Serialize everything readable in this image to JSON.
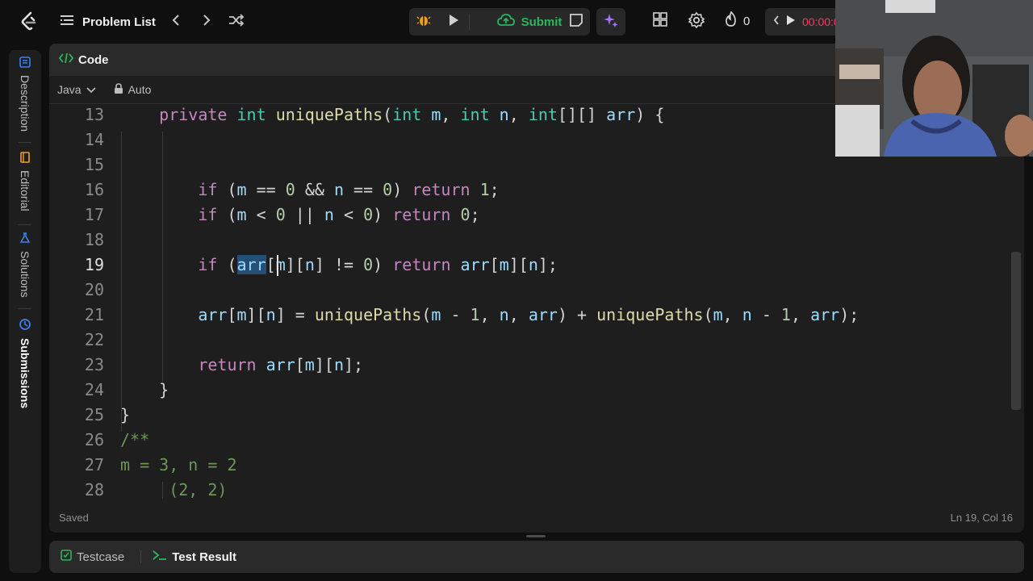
{
  "nav": {
    "problem_list_label": "Problem List",
    "submit_label": "Submit",
    "streak_count": "0",
    "timer": "00:00:0"
  },
  "sidebar": {
    "tabs": [
      {
        "label": "Description"
      },
      {
        "label": "Editorial"
      },
      {
        "label": "Solutions"
      },
      {
        "label": "Submissions"
      }
    ]
  },
  "code_panel": {
    "title": "Code",
    "language": "Java",
    "mode": "Auto",
    "status": "Saved",
    "cursor_position": "Ln 19, Col 16"
  },
  "editor": {
    "line_numbers": [
      "13",
      "14",
      "15",
      "16",
      "17",
      "18",
      "19",
      "20",
      "21",
      "22",
      "23",
      "24",
      "25",
      "26",
      "27",
      "28"
    ],
    "selected_token": "arr"
  },
  "bottom_panel": {
    "tabs": [
      {
        "label": "Testcase"
      },
      {
        "label": "Test Result"
      }
    ]
  },
  "colors": {
    "accent_submit": "#2db55d",
    "timer": "#ff375f",
    "ai_icon": "#a974ff",
    "keyword": "#c586c0",
    "type": "#4ec9b0",
    "function": "#dcdcaa",
    "variable": "#9cdcfe",
    "number": "#b5cea8",
    "comment": "#6a9955"
  }
}
